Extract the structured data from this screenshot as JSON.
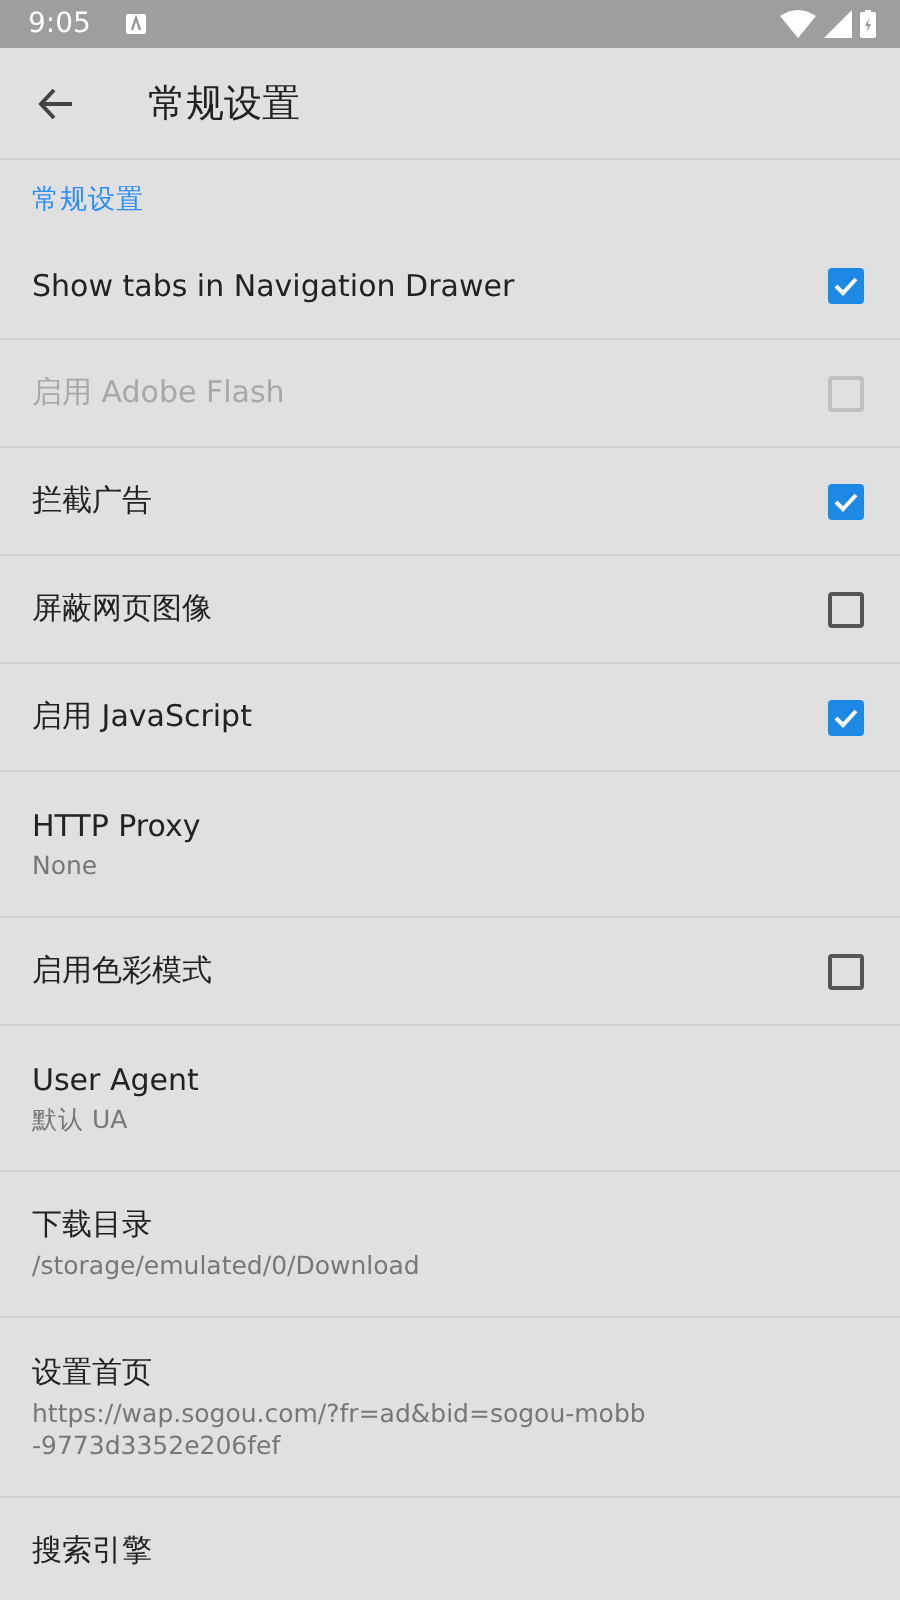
{
  "status_bar": {
    "time": "9:05"
  },
  "app_bar": {
    "title": "常规设置"
  },
  "category": {
    "title": "常规设置"
  },
  "items": [
    {
      "kind": "checkbox",
      "title": "Show tabs in Navigation Drawer",
      "checked": true,
      "disabled": false
    },
    {
      "kind": "checkbox",
      "title": "启用 Adobe Flash",
      "checked": false,
      "disabled": true
    },
    {
      "kind": "checkbox",
      "title": "拦截广告",
      "checked": true,
      "disabled": false
    },
    {
      "kind": "checkbox",
      "title": "屏蔽网页图像",
      "checked": false,
      "disabled": false
    },
    {
      "kind": "checkbox",
      "title": "启用 JavaScript",
      "checked": true,
      "disabled": false
    },
    {
      "kind": "text",
      "title": "HTTP Proxy",
      "summary": "None"
    },
    {
      "kind": "checkbox",
      "title": "启用色彩模式",
      "checked": false,
      "disabled": false
    },
    {
      "kind": "text",
      "title": "User Agent",
      "summary": "默认 UA"
    },
    {
      "kind": "text",
      "title": "下载目录",
      "summary": "/storage/emulated/0/Download"
    },
    {
      "kind": "text",
      "title": "设置首页",
      "summary": "https://wap.sogou.com/?fr=ad&bid=sogou-mobb-9773d3352e206fef"
    },
    {
      "kind": "text",
      "title": "搜索引擎"
    }
  ]
}
